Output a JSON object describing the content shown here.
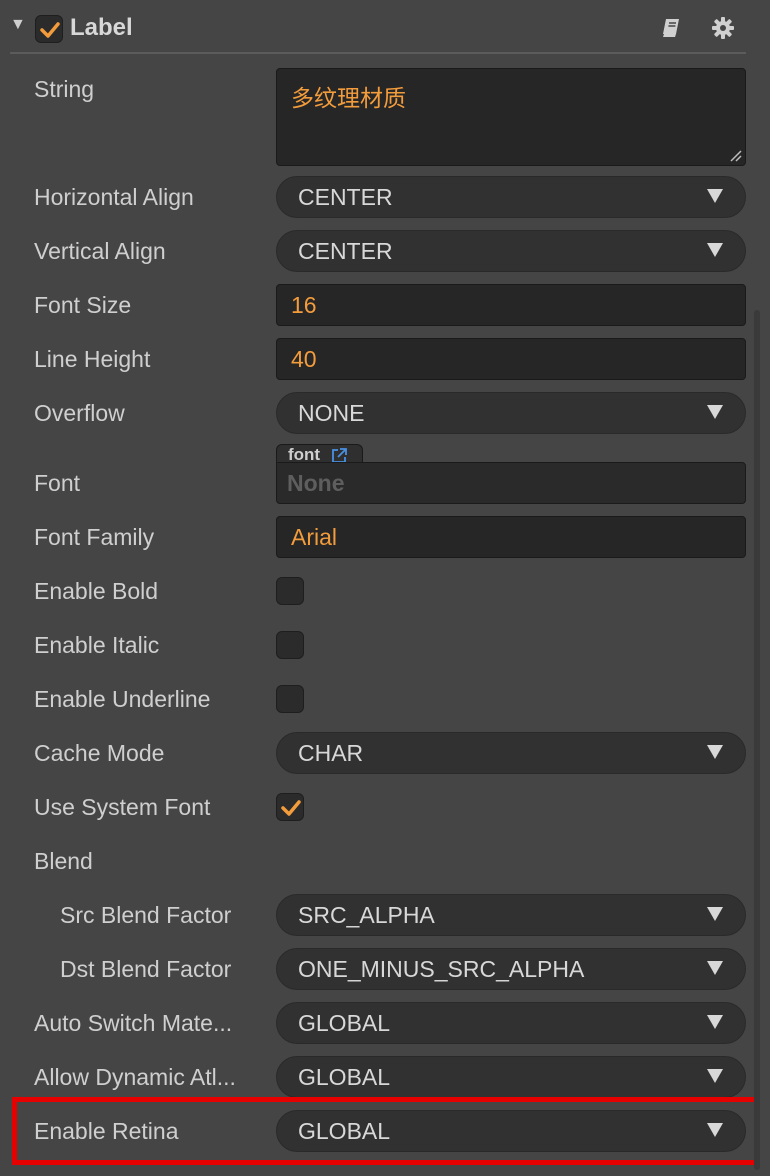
{
  "component": {
    "title": "Label",
    "enabled": true
  },
  "fields": {
    "string": {
      "label": "String",
      "value": "多纹理材质"
    },
    "horizontal_align": {
      "label": "Horizontal Align",
      "value": "CENTER"
    },
    "vertical_align": {
      "label": "Vertical Align",
      "value": "CENTER"
    },
    "font_size": {
      "label": "Font Size",
      "value": "16"
    },
    "line_height": {
      "label": "Line Height",
      "value": "40"
    },
    "overflow": {
      "label": "Overflow",
      "value": "NONE"
    },
    "font": {
      "label": "Font",
      "asset_type": "font",
      "value": "None"
    },
    "font_family": {
      "label": "Font Family",
      "value": "Arial"
    },
    "enable_bold": {
      "label": "Enable Bold",
      "checked": false
    },
    "enable_italic": {
      "label": "Enable Italic",
      "checked": false
    },
    "enable_underline": {
      "label": "Enable Underline",
      "checked": false
    },
    "cache_mode": {
      "label": "Cache Mode",
      "value": "CHAR"
    },
    "use_system_font": {
      "label": "Use System Font",
      "checked": true
    },
    "blend": {
      "label": "Blend"
    },
    "src_blend_factor": {
      "label": "Src Blend Factor",
      "value": "SRC_ALPHA"
    },
    "dst_blend_factor": {
      "label": "Dst Blend Factor",
      "value": "ONE_MINUS_SRC_ALPHA"
    },
    "auto_switch_material": {
      "label": "Auto Switch Mate...",
      "value": "GLOBAL"
    },
    "allow_dynamic_atlas": {
      "label": "Allow Dynamic Atl...",
      "value": "GLOBAL"
    },
    "enable_retina": {
      "label": "Enable Retina",
      "value": "GLOBAL"
    }
  },
  "icons": {
    "fold": "triangle-down-icon",
    "docs": "book-icon",
    "settings": "gear-icon",
    "asset_link": "external-link-icon"
  },
  "colors": {
    "accent": "#f39c3c",
    "highlight_border": "#e60000",
    "panel_bg": "#454545",
    "link": "#4a90e2"
  }
}
